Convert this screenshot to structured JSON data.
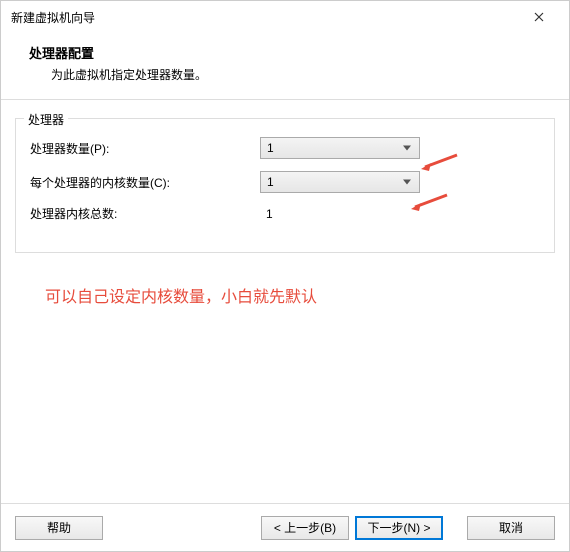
{
  "window": {
    "title": "新建虚拟机向导"
  },
  "header": {
    "title": "处理器配置",
    "subtitle": "为此虚拟机指定处理器数量。"
  },
  "fieldset": {
    "legend": "处理器",
    "rows": {
      "processors": {
        "label": "处理器数量(P):",
        "value": "1"
      },
      "cores": {
        "label": "每个处理器的内核数量(C):",
        "value": "1"
      },
      "total": {
        "label": "处理器内核总数:",
        "value": "1"
      }
    }
  },
  "annotation": "可以自己设定内核数量，小白就先默认",
  "footer": {
    "help": "帮助",
    "back": "< 上一步(B)",
    "next": "下一步(N) >",
    "cancel": "取消"
  }
}
